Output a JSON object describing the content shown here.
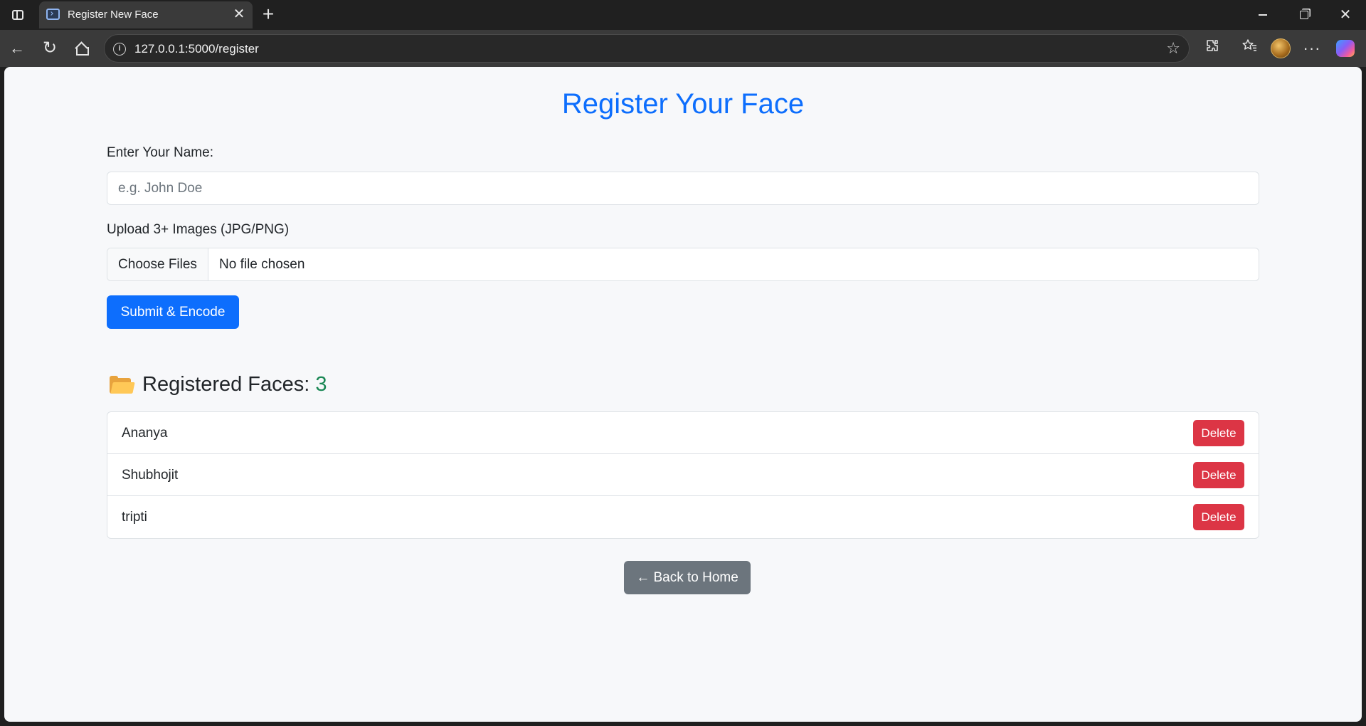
{
  "browser": {
    "tab_title": "Register New Face",
    "tab_close": "✕",
    "new_tab": "+",
    "url": "127.0.0.1:5000/register",
    "info_glyph": "i",
    "star_glyph": "☆",
    "more_glyph": "···",
    "back_glyph": "←",
    "reload_glyph": "↻",
    "close_glyph": "✕",
    "icons": [
      "sidebar-toggle-icon",
      "page-favicon",
      "info-icon",
      "favorite-star-icon",
      "extensions-icon",
      "favorites-icon",
      "profile-avatar",
      "more-icon",
      "copilot-icon"
    ]
  },
  "page": {
    "title": "Register Your Face",
    "name_label": "Enter Your Name:",
    "name_placeholder": "e.g. John Doe",
    "name_value": "",
    "upload_label": "Upload 3+ Images (JPG/PNG)",
    "choose_files": "Choose Files",
    "file_status": "No file chosen",
    "submit": "Submit & Encode",
    "registered_heading": "Registered Faces:",
    "registered_count": "3",
    "faces": [
      {
        "name": "Ananya",
        "action": "Delete"
      },
      {
        "name": "Shubhojit",
        "action": "Delete"
      },
      {
        "name": "tripti",
        "action": "Delete"
      }
    ],
    "back_home": "← Back to Home"
  },
  "colors": {
    "primary": "#0d6efd",
    "danger": "#dc3545",
    "secondary": "#6c757d",
    "success": "#198754",
    "page_bg": "#f7f8fa",
    "chrome_bg": "#202020"
  }
}
